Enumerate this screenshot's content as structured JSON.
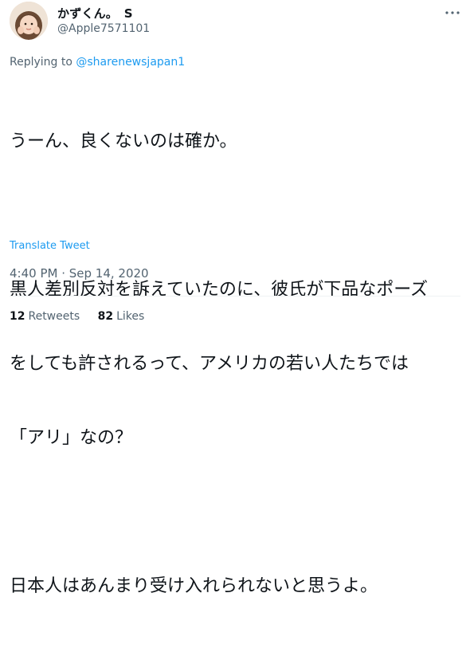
{
  "author": {
    "display_name": "かずくん。　S",
    "username": "@Apple7571101"
  },
  "reply": {
    "prefix": "Replying to ",
    "handle": "@sharenewsjapan1"
  },
  "tweet": {
    "lines": {
      "l1": "うーん、良くないのは確か。",
      "l2": "黒人差別反対を訴えていたのに、彼氏が下品なポーズ",
      "l3": "をしても許されるって、アメリカの若い人たちでは",
      "l4": "「アリ」なの？",
      "l5": "日本人はあんまり受け入れられないと思うよ。"
    },
    "translate_label": "Translate Tweet",
    "timestamp": "4:40 PM · Sep 14, 2020"
  },
  "stats": {
    "retweets_count": "12",
    "retweets_label": "Retweets",
    "likes_count": "82",
    "likes_label": "Likes"
  },
  "colors": {
    "link": "#1d9bf0",
    "secondary_text": "#536471",
    "primary_text": "#0f1419"
  },
  "icons": {
    "more": "more-horizontal-icon"
  }
}
